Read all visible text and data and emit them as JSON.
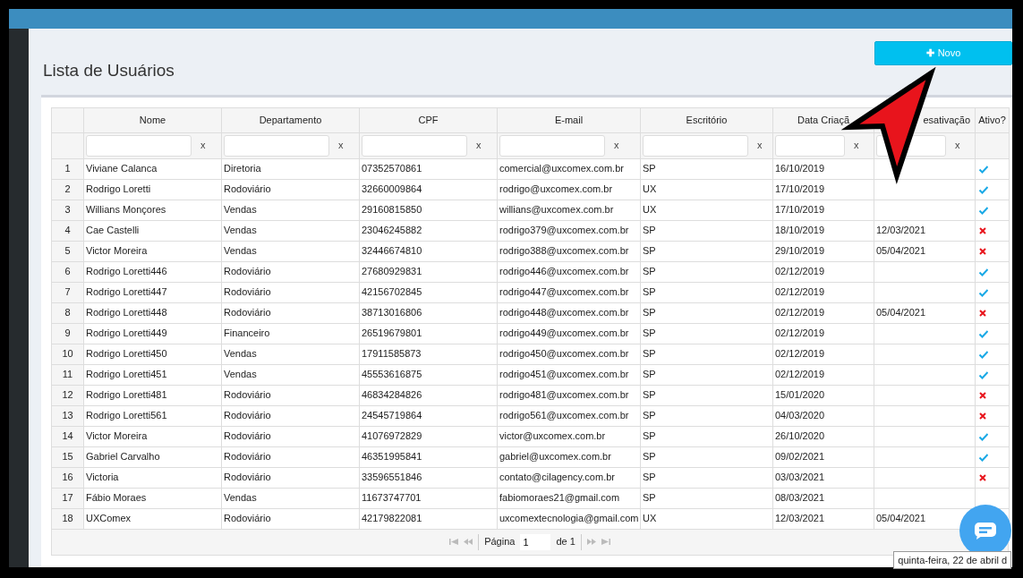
{
  "page_title": "Lista de Usuários",
  "new_button": {
    "icon": "✚",
    "label": "Novo"
  },
  "table": {
    "columns": [
      "Nome",
      "Departamento",
      "CPF",
      "E-mail",
      "Escritório",
      "Data Criaçã",
      "esativação",
      "Ativo?"
    ],
    "filters": [
      "x",
      "x",
      "x",
      "x",
      "x",
      "x",
      "x"
    ],
    "rows": [
      {
        "n": "1",
        "nome": "Viviane Calanca",
        "departamento": "Diretoria",
        "cpf": "07352570861",
        "email": "comercial@uxcomex.com.br",
        "escritorio": "SP",
        "data_criacao": "16/10/2019",
        "active": true
      },
      {
        "n": "2",
        "nome": "Rodrigo Loretti",
        "departamento": "Rodoviário",
        "cpf": "32660009864",
        "email": "rodrigo@uxcomex.com.br",
        "escritorio": "UX",
        "data_criacao": "17/10/2019",
        "active": true
      },
      {
        "n": "3",
        "nome": "Willians Monçores",
        "departamento": "Vendas",
        "cpf": "29160815850",
        "email": "willians@uxcomex.com.br",
        "escritorio": "UX",
        "data_criacao": "17/10/2019",
        "active": true
      },
      {
        "n": "4",
        "nome": "Cae Castelli",
        "departamento": "Vendas",
        "cpf": "23046245882",
        "email": "rodrigo379@uxcomex.com.br",
        "escritorio": "SP",
        "data_criacao": "18/10/2019",
        "data_desativacao": "12/03/2021",
        "active": false
      },
      {
        "n": "5",
        "nome": "Victor Moreira",
        "departamento": "Vendas",
        "cpf": "32446674810",
        "email": "rodrigo388@uxcomex.com.br",
        "escritorio": "SP",
        "data_criacao": "29/10/2019",
        "data_desativacao": "05/04/2021",
        "active": false
      },
      {
        "n": "6",
        "nome": "Rodrigo Loretti446",
        "departamento": "Rodoviário",
        "cpf": "27680929831",
        "email": "rodrigo446@uxcomex.com.br",
        "escritorio": "SP",
        "data_criacao": "02/12/2019",
        "active": true
      },
      {
        "n": "7",
        "nome": "Rodrigo Loretti447",
        "departamento": "Rodoviário",
        "cpf": "42156702845",
        "email": "rodrigo447@uxcomex.com.br",
        "escritorio": "SP",
        "data_criacao": "02/12/2019",
        "active": true
      },
      {
        "n": "8",
        "nome": "Rodrigo Loretti448",
        "departamento": "Rodoviário",
        "cpf": "38713016806",
        "email": "rodrigo448@uxcomex.com.br",
        "escritorio": "SP",
        "data_criacao": "02/12/2019",
        "data_desativacao": "05/04/2021",
        "active": false
      },
      {
        "n": "9",
        "nome": "Rodrigo Loretti449",
        "departamento": "Financeiro",
        "cpf": "26519679801",
        "email": "rodrigo449@uxcomex.com.br",
        "escritorio": "SP",
        "data_criacao": "02/12/2019",
        "active": true
      },
      {
        "n": "10",
        "nome": "Rodrigo Loretti450",
        "departamento": "Vendas",
        "cpf": "17911585873",
        "email": "rodrigo450@uxcomex.com.br",
        "escritorio": "SP",
        "data_criacao": "02/12/2019",
        "active": true
      },
      {
        "n": "11",
        "nome": "Rodrigo Loretti451",
        "departamento": "Vendas",
        "cpf": "45553616875",
        "email": "rodrigo451@uxcomex.com.br",
        "escritorio": "SP",
        "data_criacao": "02/12/2019",
        "active": true
      },
      {
        "n": "12",
        "nome": "Rodrigo Loretti481",
        "departamento": "Rodoviário",
        "cpf": "46834284826",
        "email": "rodrigo481@uxcomex.com.br",
        "escritorio": "SP",
        "data_criacao": "15/01/2020",
        "active": false
      },
      {
        "n": "13",
        "nome": "Rodrigo Loretti561",
        "departamento": "Rodoviário",
        "cpf": "24545719864",
        "email": "rodrigo561@uxcomex.com.br",
        "escritorio": "SP",
        "data_criacao": "04/03/2020",
        "active": false
      },
      {
        "n": "14",
        "nome": "Victor Moreira",
        "departamento": "Rodoviário",
        "cpf": "41076972829",
        "email": "victor@uxcomex.com.br",
        "escritorio": "SP",
        "data_criacao": "26/10/2020",
        "active": true
      },
      {
        "n": "15",
        "nome": "Gabriel Carvalho",
        "departamento": "Rodoviário",
        "cpf": "46351995841",
        "email": "gabriel@uxcomex.com.br",
        "escritorio": "SP",
        "data_criacao": "09/02/2021",
        "active": true
      },
      {
        "n": "16",
        "nome": "Victoria",
        "departamento": "Rodoviário",
        "cpf": "33596551846",
        "email": "contato@cilagency.com.br",
        "escritorio": "SP",
        "data_criacao": "03/03/2021",
        "active": false
      },
      {
        "n": "17",
        "nome": "Fábio Moraes",
        "departamento": "Vendas",
        "cpf": "11673747701",
        "email": "fabiomoraes21@gmail.com",
        "escritorio": "SP",
        "data_criacao": "08/03/2021"
      },
      {
        "n": "18",
        "nome": "UXComex",
        "departamento": "Rodoviário",
        "cpf": "42179822081",
        "email": "uxcomextecnologia@gmail.com",
        "escritorio": "UX",
        "data_criacao": "12/03/2021",
        "data_desativacao": "05/04/2021"
      }
    ]
  },
  "pager": {
    "page_label": "Página",
    "page_value": "1",
    "of_label": "de 1"
  },
  "tooltip": "quinta-feira, 22 de abril d"
}
